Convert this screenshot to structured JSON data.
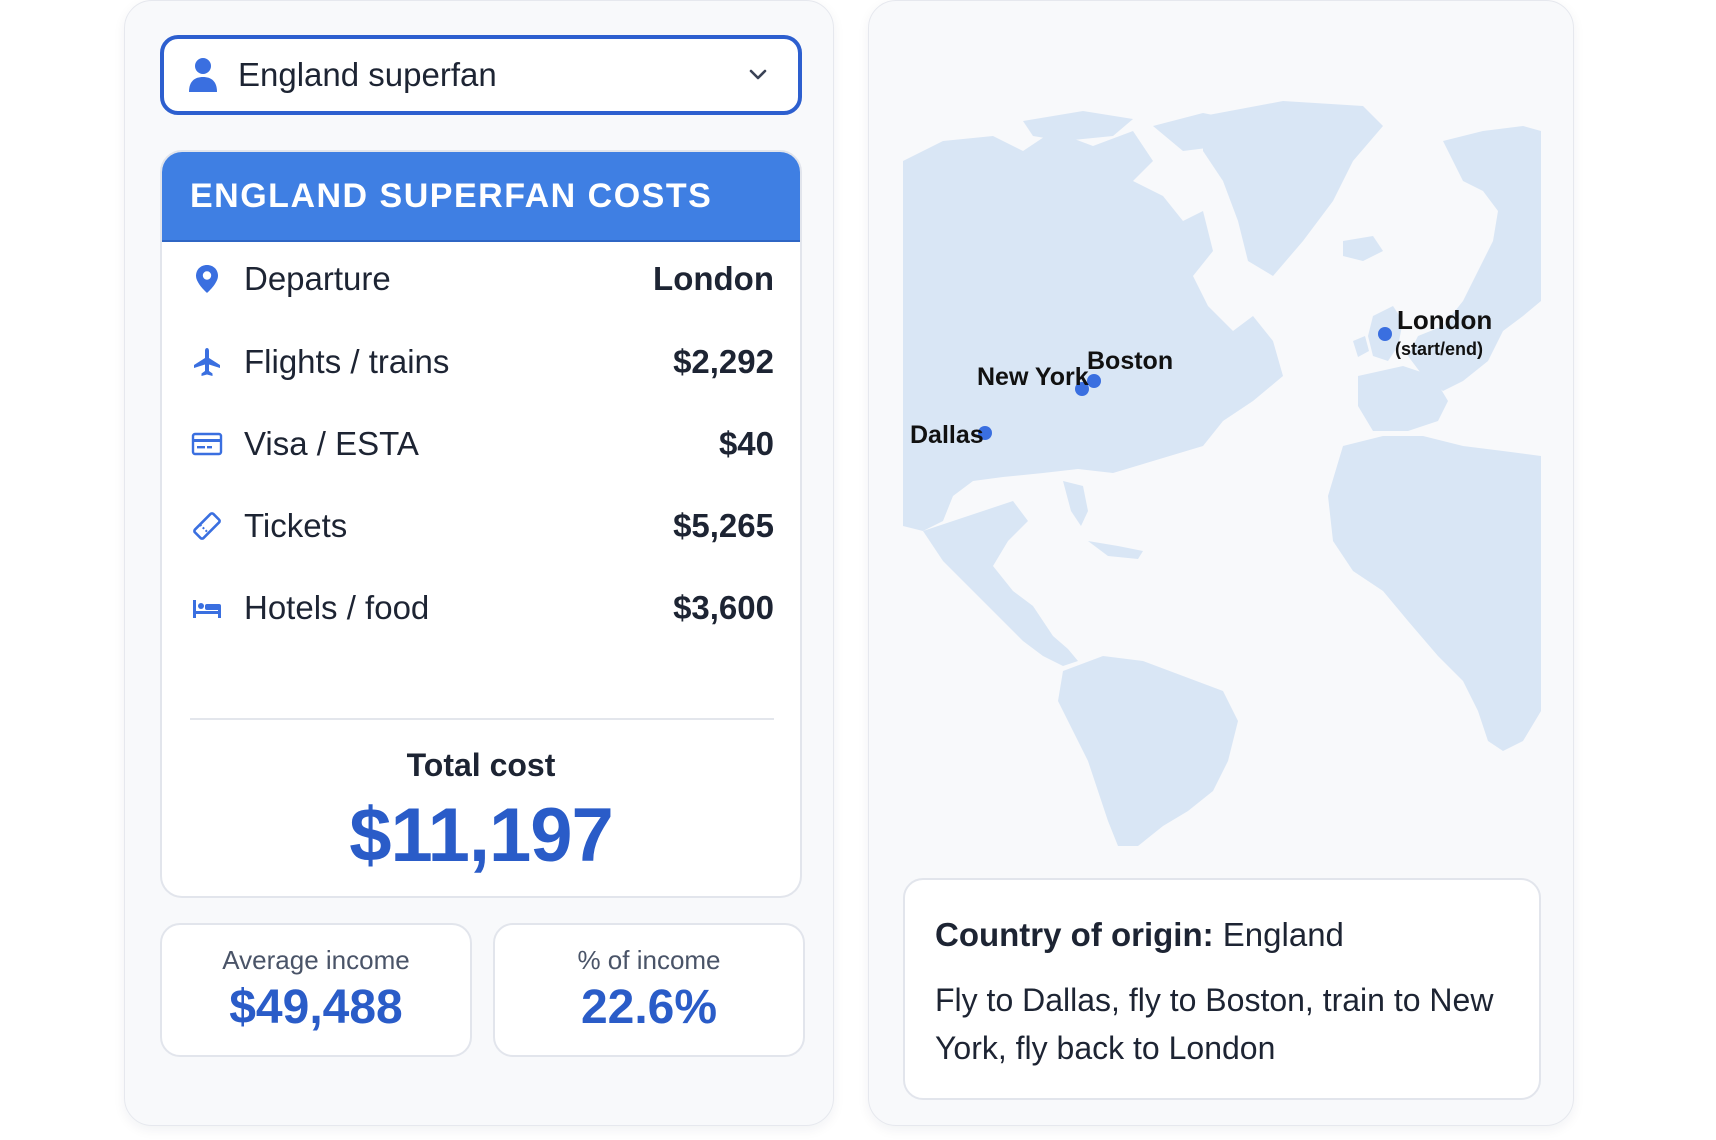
{
  "selector": {
    "value": "England superfan",
    "icon": "person-icon"
  },
  "costs": {
    "title": "ENGLAND SUPERFAN COSTS",
    "rows": [
      {
        "icon": "map-pin-icon",
        "label": "Departure",
        "value": "London"
      },
      {
        "icon": "airplane-icon",
        "label": "Flights / trains",
        "value": "$2,292"
      },
      {
        "icon": "credit-card-icon",
        "label": "Visa / ESTA",
        "value": "$40"
      },
      {
        "icon": "ticket-icon",
        "label": "Tickets",
        "value": "$5,265"
      },
      {
        "icon": "bed-icon",
        "label": "Hotels / food",
        "value": "$3,600"
      }
    ],
    "total_label": "Total cost",
    "total_value": "$11,197"
  },
  "stats": {
    "income_label": "Average income",
    "income_value": "$49,488",
    "pct_label": "% of income",
    "pct_value": "22.6%"
  },
  "map": {
    "cities": [
      {
        "name": "Dallas"
      },
      {
        "name": "Boston"
      },
      {
        "name": "New York"
      },
      {
        "name": "London",
        "note": "(start/end)"
      }
    ]
  },
  "info": {
    "origin_label": "Country of origin:",
    "origin_value": "England",
    "description": "Fly to Dallas, fly to Boston, train to New York, fly back to London"
  },
  "colors": {
    "accent": "#2a5cc8",
    "header": "#3f7fe3",
    "land": "#d9e6f5",
    "dot": "#3a6fe0"
  }
}
